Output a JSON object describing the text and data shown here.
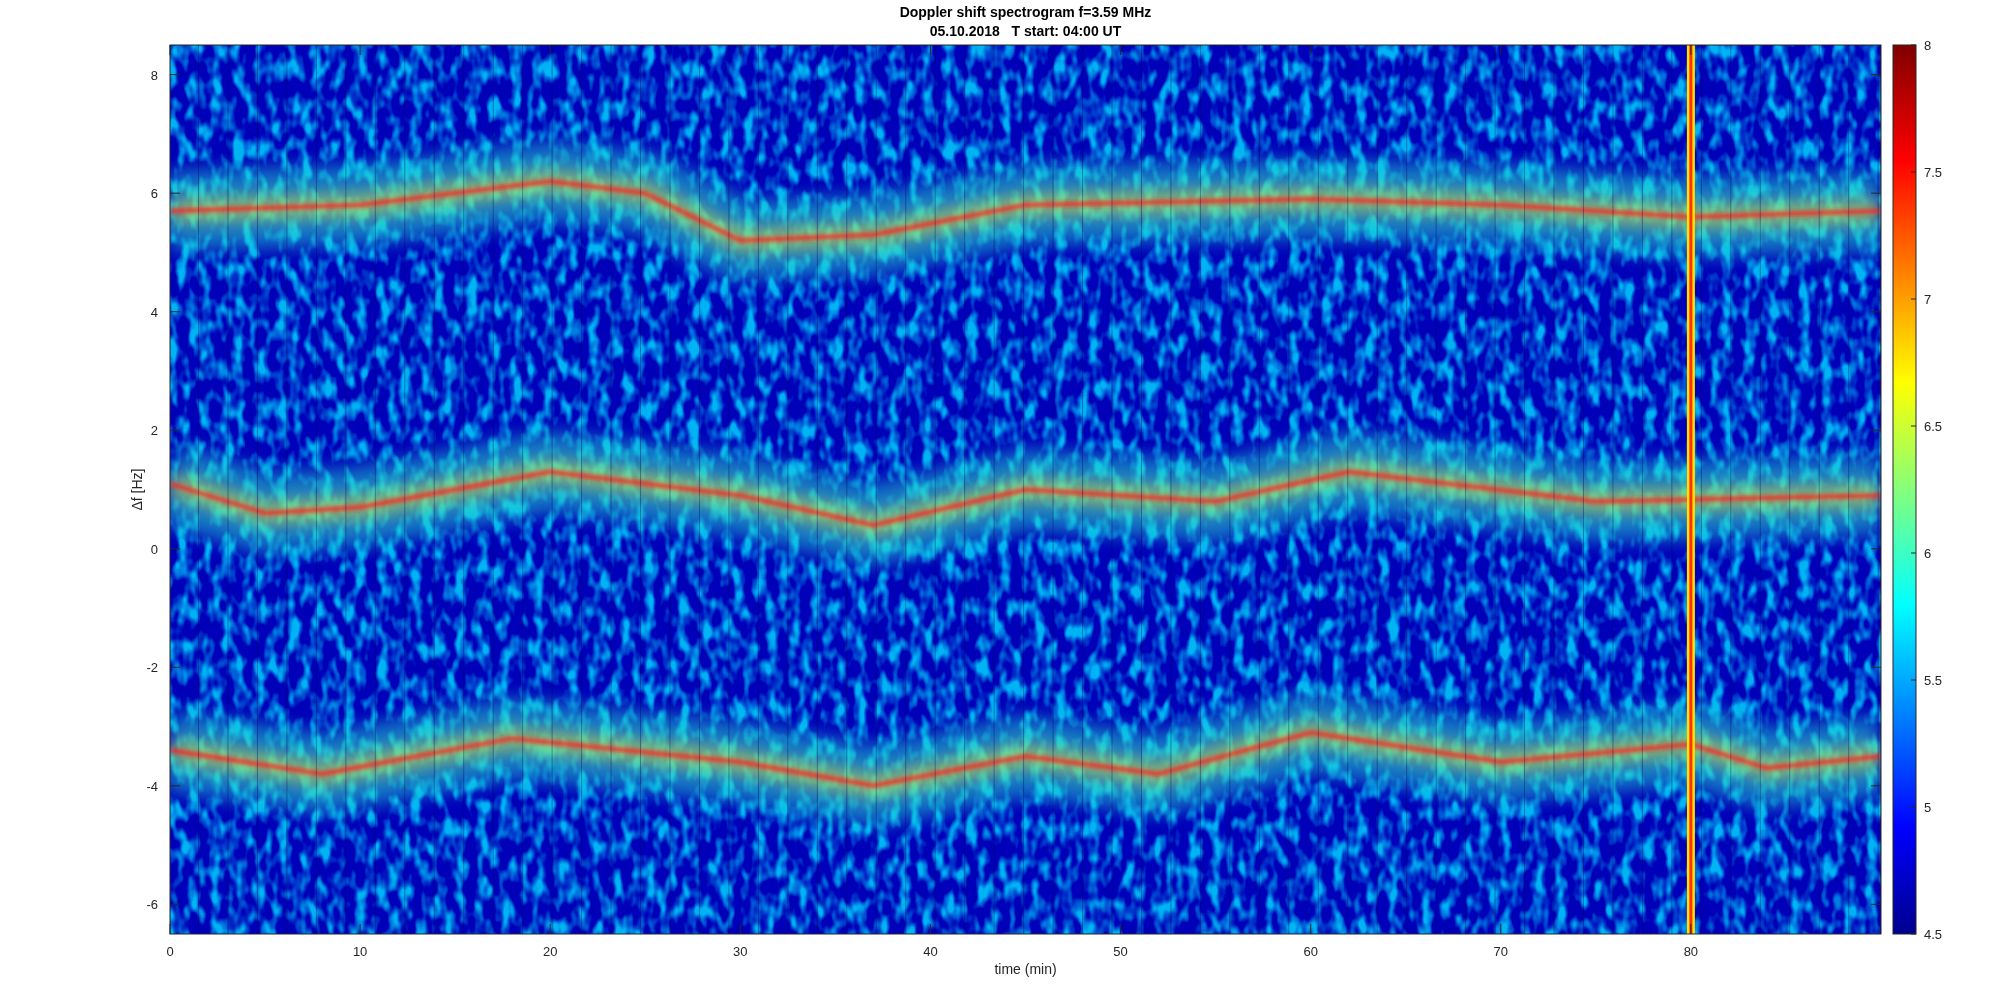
{
  "figure": {
    "title": "Doppler shift spectrogram f=3.59 MHz",
    "subtitle": "05.10.2018   T start: 04:00 UT",
    "xlabel": "time (min)",
    "ylabel": "Δf [Hz]",
    "xticks": [
      "0",
      "10",
      "20",
      "30",
      "40",
      "50",
      "60",
      "70",
      "80"
    ],
    "yticks": [
      "8",
      "6",
      "4",
      "2",
      "0",
      "-2",
      "-4",
      "-6"
    ],
    "colorbar": {
      "ticks": [
        "8",
        "7.5",
        "7",
        "6.5",
        "6",
        "5.5",
        "5",
        "4.5"
      ]
    }
  }
}
